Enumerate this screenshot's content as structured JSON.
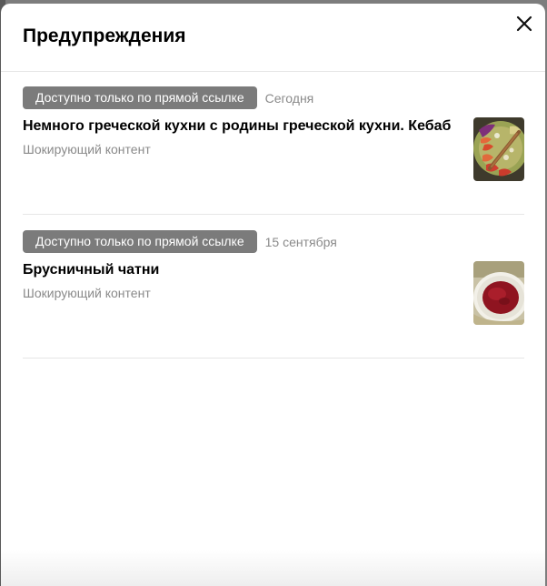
{
  "modal": {
    "title": "Предупреждения",
    "close_icon": "close-icon"
  },
  "warnings": [
    {
      "badge": "Доступно только по прямой ссылке",
      "date": "Сегодня",
      "title": "Немного греческой кухни с родины греческой кухни. Кебаб",
      "subtitle": "Шокирующий контент",
      "thumbnail": "kebab-plate-thumbnail"
    },
    {
      "badge": "Доступно только по прямой ссылке",
      "date": "15 сентября",
      "title": "Брусничный чатни",
      "subtitle": "Шокирующий контент",
      "thumbnail": "chutney-bowl-thumbnail"
    }
  ],
  "colors": {
    "badge_bg": "#7b7b7b",
    "muted_text": "#8a8a8a",
    "divider": "#e6e6e6"
  }
}
